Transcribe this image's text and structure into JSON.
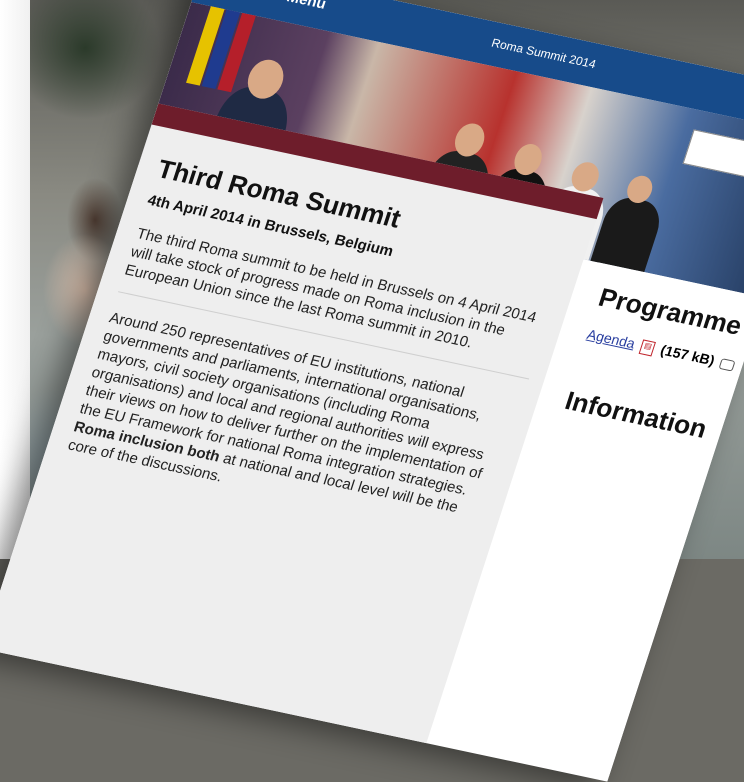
{
  "header": {
    "menu_label": "Menu",
    "site_title": "Roma Summit 2014"
  },
  "article": {
    "title": "Third Roma Summit",
    "subtitle": "4th April 2014 in Brussels, Belgium",
    "intro": "The third Roma summit to be held in Brussels on 4 April 2014 will take stock of progress made on Roma inclusion in the European Union since the last Roma summit in 2010.",
    "body_part1": "Around 250 representatives of EU institutions, national governments and parliaments, international organisations, mayors, civil society organisations (including Roma organisations) and local and regional authorities will express their views on how to deliver further on the implementation of the EU Framework for national Roma integration strategies. ",
    "body_bold": "Roma inclusion both",
    "body_part2": " at national and local level will be the core of the discussions."
  },
  "sidebar": {
    "programme_heading": "Programme",
    "agenda_link": "Agenda",
    "agenda_size": "(157 kB)",
    "info_heading": "Information"
  },
  "colors": {
    "header_blue": "#174b8a",
    "card_band": "#6e1d2b",
    "link": "#2a3fa0"
  },
  "icons": [
    "pdf-icon",
    "comment-icon"
  ]
}
